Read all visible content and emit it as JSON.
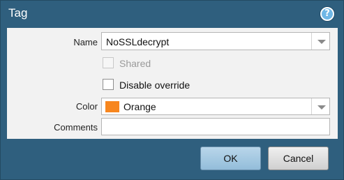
{
  "dialog": {
    "title": "Tag",
    "help_icon": "question-mark-icon"
  },
  "form": {
    "name_label": "Name",
    "name_value": "NoSSLdecrypt",
    "shared_label": "Shared",
    "shared_checked": false,
    "shared_disabled": true,
    "disable_override_label": "Disable override",
    "disable_override_checked": false,
    "color_label": "Color",
    "color_value": "Orange",
    "color_swatch": "#f7861e",
    "comments_label": "Comments",
    "comments_value": ""
  },
  "buttons": {
    "ok": "OK",
    "cancel": "Cancel"
  },
  "colors": {
    "frame": "#2f5f7e",
    "panel": "#f2f2f2",
    "ok_button": "#a7c9e1"
  }
}
